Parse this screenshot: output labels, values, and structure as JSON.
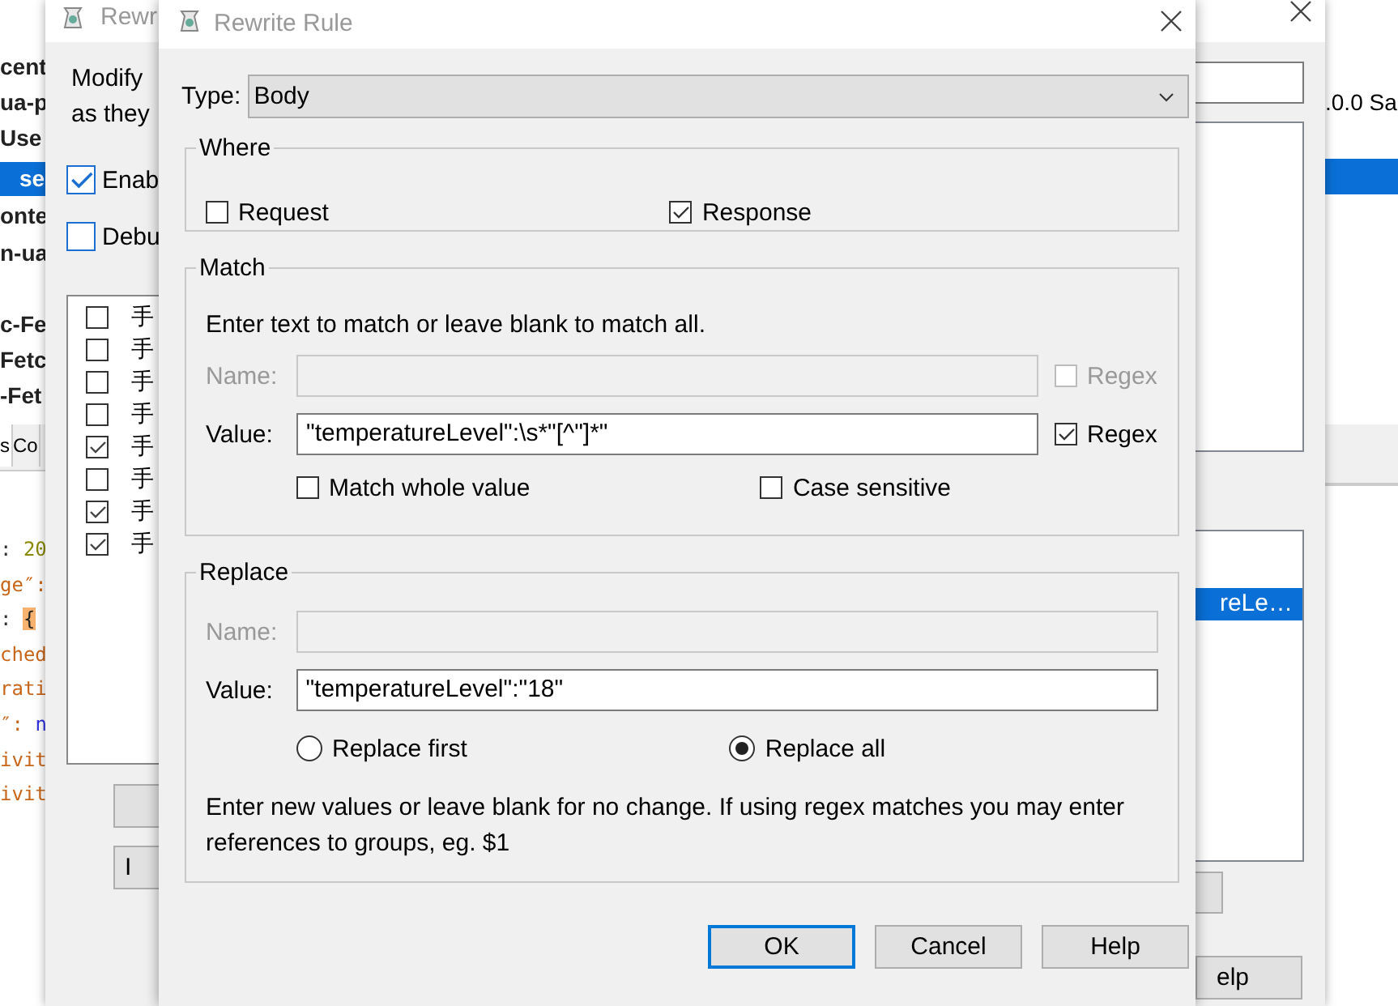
{
  "background_app": {
    "list_items": [
      {
        "text": "cent",
        "selected": false
      },
      {
        "text": "ua-p",
        "selected": false
      },
      {
        "text": "Use",
        "selected": false
      },
      {
        "text": "se",
        "selected": true
      },
      {
        "text": "onte",
        "selected": false
      },
      {
        "text": "n-ua",
        "selected": false
      }
    ],
    "request_items": [
      "c-Fe",
      "Fetc",
      "-Fet"
    ],
    "tabs": [
      {
        "label": "s",
        "selected": true
      },
      {
        "label": "Co",
        "selected": false
      }
    ],
    "code_lines": [
      [
        {
          "text": ": ",
          "kind": "punct"
        },
        {
          "text": "20",
          "kind": "number"
        }
      ],
      [
        {
          "text": "ge″:",
          "kind": "key"
        }
      ],
      [
        {
          "text": ": ",
          "kind": "punct"
        },
        {
          "text": "{",
          "kind": "bracket"
        }
      ],
      [
        {
          "text": "ched",
          "kind": "key"
        }
      ],
      [
        {
          "text": "rati",
          "kind": "key"
        }
      ],
      [
        {
          "text": "″: ",
          "kind": "key"
        },
        {
          "text": "n",
          "kind": "literal"
        }
      ],
      [
        {
          "text": "ivit",
          "kind": "key"
        }
      ],
      [
        {
          "text": "ivit",
          "kind": "key"
        }
      ]
    ],
    "right_text": ".0.0 Sa"
  },
  "rules_window": {
    "title": "Rewr",
    "description_lines": [
      "Modify",
      "as they"
    ],
    "options": [
      {
        "label": "Enab",
        "checked": true
      },
      {
        "label": "Debu",
        "checked": false
      }
    ],
    "rules": [
      {
        "label": "手",
        "checked": false
      },
      {
        "label": "手",
        "checked": false
      },
      {
        "label": "手",
        "checked": false
      },
      {
        "label": "手",
        "checked": false
      },
      {
        "label": "手",
        "checked": true
      },
      {
        "label": "手",
        "checked": false
      },
      {
        "label": "手",
        "checked": true
      },
      {
        "label": "手",
        "checked": true
      }
    ],
    "left_buttons": [
      "I"
    ],
    "selected_rewrite": "reLe…",
    "help_button": "elp"
  },
  "dialog": {
    "title": "Rewrite Rule",
    "type_label": "Type:",
    "type_value": "Body",
    "where": {
      "title": "Where",
      "options": [
        {
          "label": "Request",
          "checked": false
        },
        {
          "label": "Response",
          "checked": true
        }
      ]
    },
    "match": {
      "title": "Match",
      "hint": "Enter text to match or leave blank to match all.",
      "fields": [
        {
          "label": "Name:",
          "disabled": true,
          "regex_label": "Regex",
          "regex_checked": false
        },
        {
          "label": "Value:",
          "value": "\"temperatureLevel\":\\s*\"[^\"]*\"",
          "disabled": false,
          "regex_label": "Regex",
          "regex_checked": true
        }
      ],
      "options": [
        {
          "label": "Match whole value",
          "checked": false
        },
        {
          "label": "Case sensitive",
          "checked": false
        }
      ]
    },
    "replace": {
      "title": "Replace",
      "fields": [
        {
          "label": "Name:",
          "disabled": true
        },
        {
          "label": "Value:",
          "value": "\"temperatureLevel\":\"18\"",
          "disabled": false
        }
      ],
      "modes": [
        {
          "label": "Replace first",
          "selected": false
        },
        {
          "label": "Replace all",
          "selected": true
        }
      ],
      "note": "Enter new values or leave blank for no change. If using regex matches you may enter references to groups, eg. $1"
    },
    "buttons": [
      {
        "label": "OK",
        "default": true
      },
      {
        "label": "Cancel",
        "default": false
      },
      {
        "label": "Help",
        "default": false
      }
    ]
  }
}
